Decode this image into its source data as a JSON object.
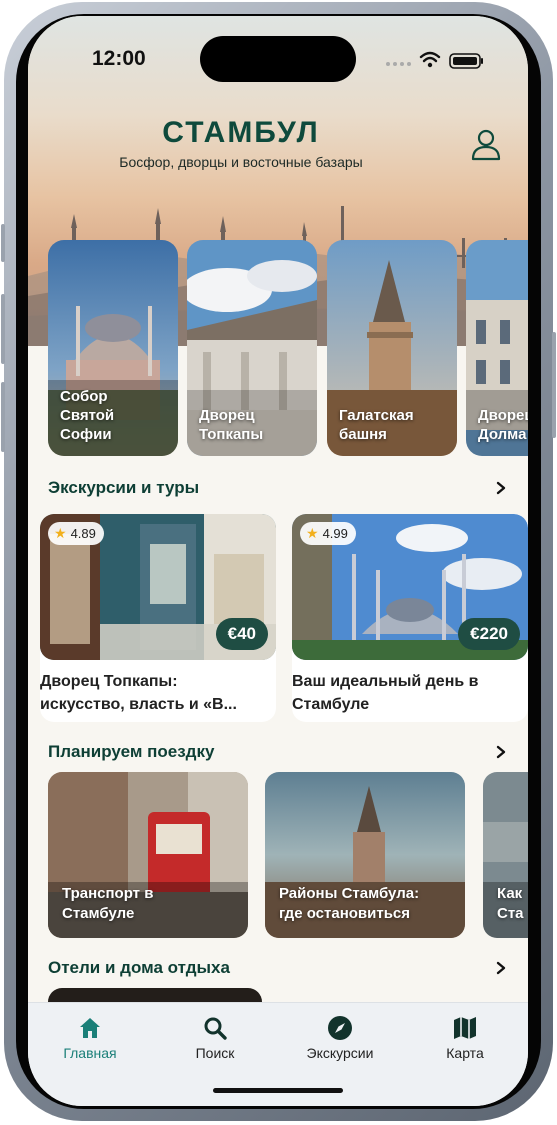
{
  "status": {
    "time": "12:00"
  },
  "header": {
    "title": "СТАМБУЛ",
    "subtitle": "Босфор, дворцы и восточные базары"
  },
  "places": [
    {
      "label": "Собор\nСвятой\nСофии"
    },
    {
      "label": "Дворец\nТопкапы"
    },
    {
      "label": "Галатская\nбашня"
    },
    {
      "label": "Дворец\nДолма"
    }
  ],
  "sections": {
    "tours_title": "Экскурсии и туры",
    "plan_title": "Планируем поездку",
    "hotels_title": "Отели и дома отдыха"
  },
  "tours": [
    {
      "rating": "4.89",
      "price": "€40",
      "name_line1": "Дворец Топкапы:",
      "name_line2": "искусство, власть и «В..."
    },
    {
      "rating": "4.99",
      "price": "€220",
      "name_line1": "Ваш идеальный день в",
      "name_line2": "Стамбуле"
    }
  ],
  "plans": [
    {
      "line1": "Транспорт в",
      "line2": "Стамбуле"
    },
    {
      "line1": "Районы Стамбула:",
      "line2": "где остановиться"
    },
    {
      "line1": "Как",
      "line2": "Ста"
    }
  ],
  "tabs": [
    {
      "label": "Главная",
      "icon": "home-icon"
    },
    {
      "label": "Поиск",
      "icon": "search-icon"
    },
    {
      "label": "Экскурсии",
      "icon": "compass-icon"
    },
    {
      "label": "Карта",
      "icon": "map-icon"
    }
  ],
  "colors": {
    "accent": "#0e4a3c",
    "active_tab": "#1a7f78",
    "price_badge": "#1f4d43",
    "star": "#f2b01e"
  }
}
